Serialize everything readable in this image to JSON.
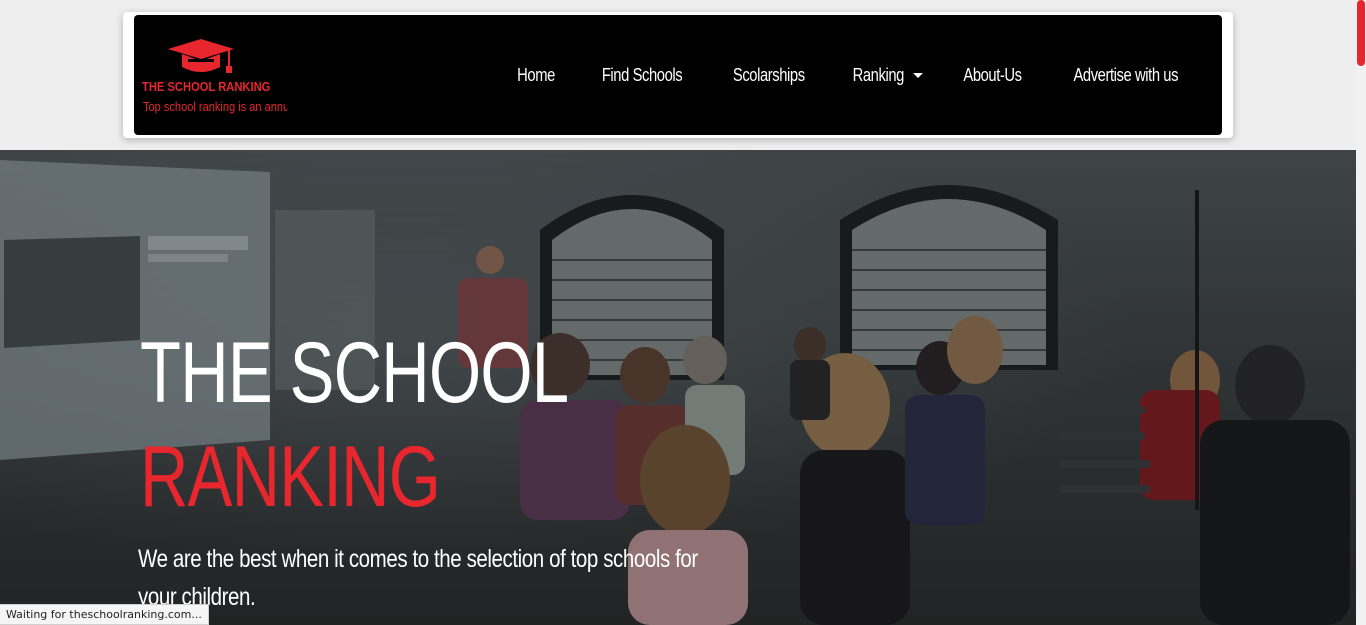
{
  "brand": {
    "title": "THE SCHOOL RANKING",
    "tagline": "Top school ranking is an annual r",
    "logo_icon": "graduation-cap-icon",
    "color": "#e8262d"
  },
  "nav": {
    "items": [
      {
        "label": "Home"
      },
      {
        "label": "Find Schools"
      },
      {
        "label": "Scolarships"
      },
      {
        "label": "Ranking",
        "dropdown": true
      },
      {
        "label": "About-Us"
      },
      {
        "label": "Advertise with us"
      }
    ]
  },
  "hero": {
    "title_line1": "THE SCHOOL",
    "title_line2": "RANKING",
    "text": "We are the best when it comes to the selection of top schools for your children."
  },
  "status": {
    "text": "Waiting for theschoolranking.com..."
  },
  "colors": {
    "accent": "#e8262d",
    "navbar_bg": "#000000",
    "page_bg": "#eeeeee"
  }
}
